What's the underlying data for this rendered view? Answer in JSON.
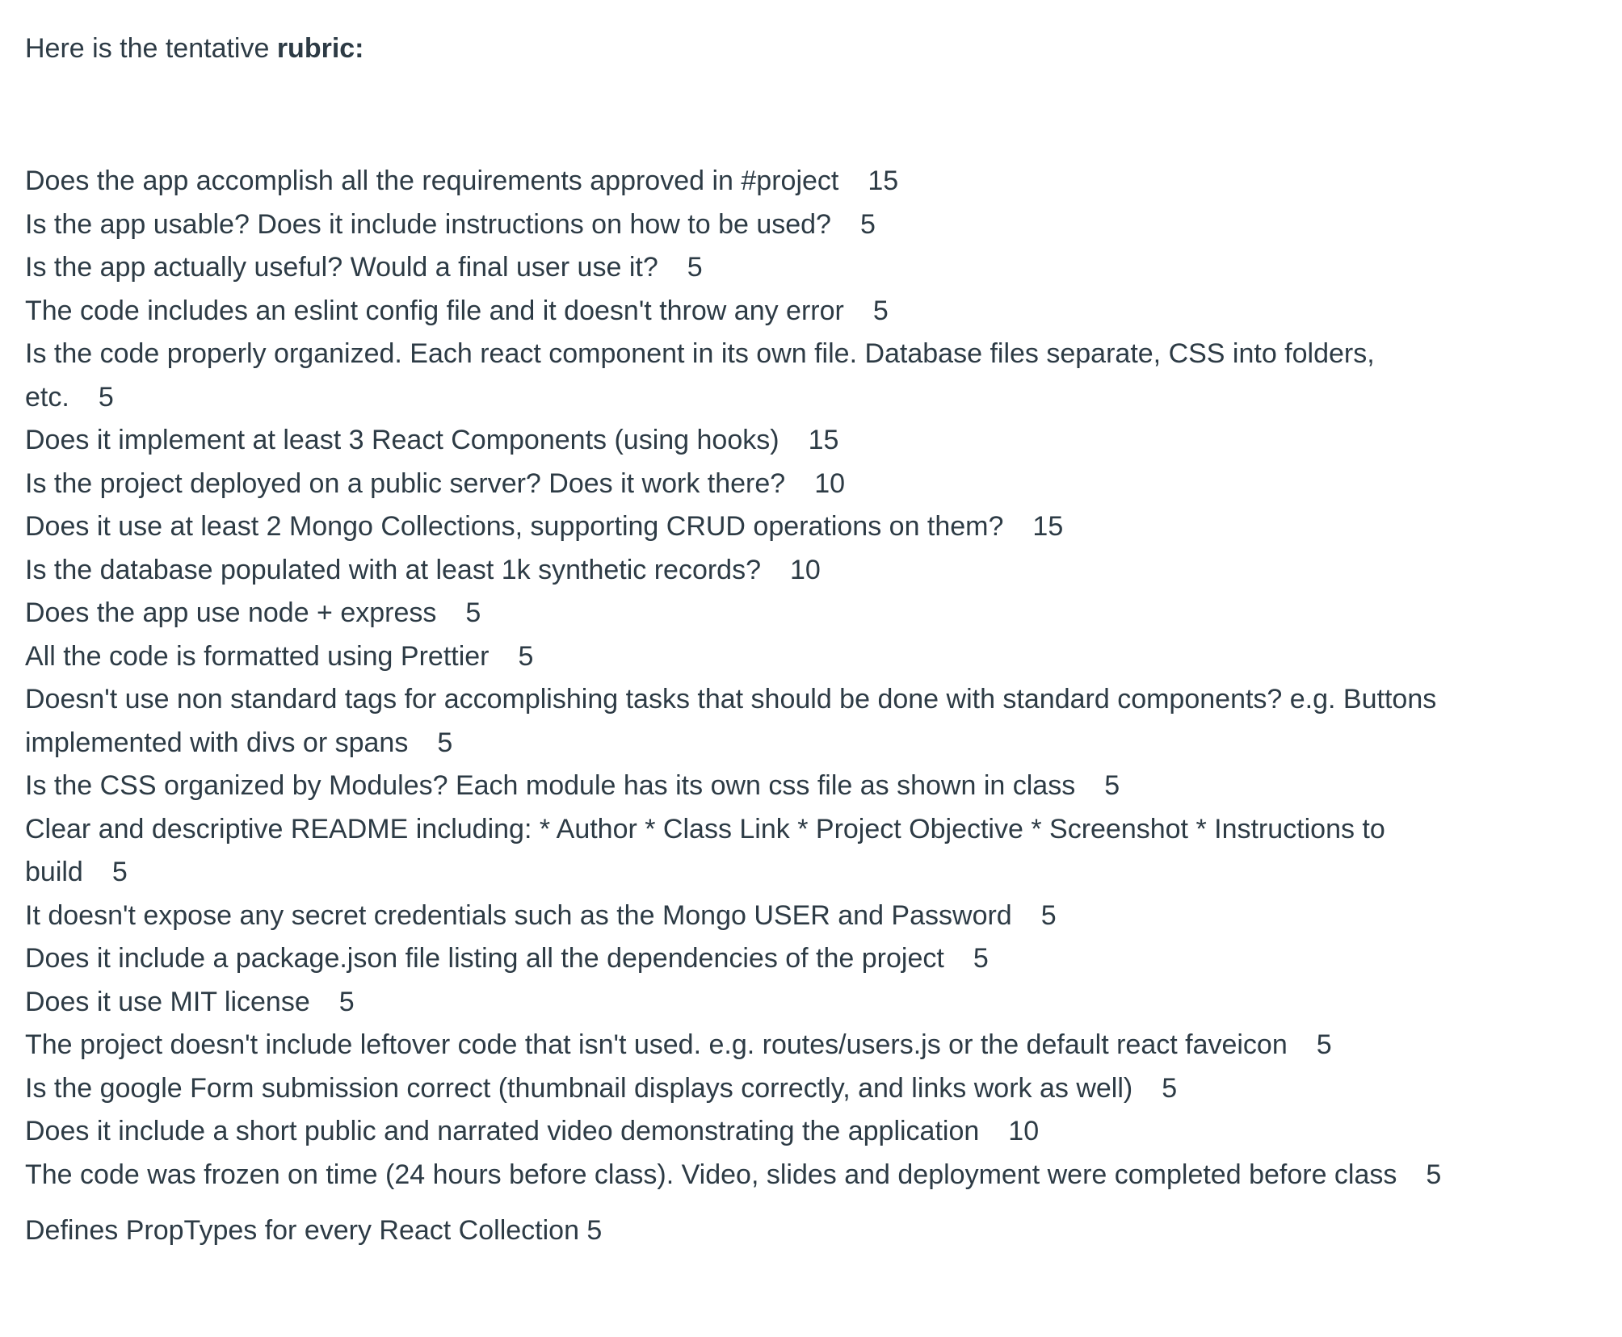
{
  "intro": {
    "text": "Here is the tentative ",
    "bold": "rubric:"
  },
  "items": [
    {
      "text": "Does the app accomplish all the requirements approved in #project",
      "points": "15"
    },
    {
      "text": "Is the app usable? Does it include instructions on how to be used?",
      "points": "5"
    },
    {
      "text": "Is the app actually useful? Would a final user use it?",
      "points": "5"
    },
    {
      "text": "The code includes an eslint config file and it doesn't throw any error",
      "points": "5"
    },
    {
      "text": "Is the code properly organized. Each react component in its own file. Database files separate, CSS into folders, etc.",
      "points": "5"
    },
    {
      "text": "Does it implement at least 3 React Components (using hooks)",
      "points": "15"
    },
    {
      "text": "Is the project deployed on a public server? Does it work there?",
      "points": "10"
    },
    {
      "text": "Does it use at least 2 Mongo Collections, supporting CRUD operations on them?",
      "points": "15"
    },
    {
      "text": "Is the database populated with at least 1k synthetic records?",
      "points": "10"
    },
    {
      "text": "Does the app use node + express",
      "points": "5"
    },
    {
      "text": "All the code is formatted using Prettier",
      "points": "5"
    },
    {
      "text": "Doesn't use non standard tags for accomplishing tasks that should be done with standard components? e.g. Buttons implemented with divs or spans",
      "points": "5"
    },
    {
      "text": "Is the CSS organized by Modules? Each module has its own css file as shown in class",
      "points": "5"
    },
    {
      "text": "Clear and descriptive README including: * Author * Class Link * Project Objective * Screenshot * Instructions to build",
      "points": "5"
    },
    {
      "text": "It doesn't expose any secret credentials such as the Mongo USER and Password",
      "points": "5"
    },
    {
      "text": "Does it include a package.json file listing all the dependencies of the project",
      "points": "5"
    },
    {
      "text": "Does it use MIT license",
      "points": "5"
    },
    {
      "text": "The project doesn't include leftover code that isn't used. e.g. routes/users.js or the default react faveicon",
      "points": "5"
    },
    {
      "text": "Is the google Form submission correct (thumbnail displays correctly, and links work as well)",
      "points": "5"
    },
    {
      "text": "Does it include a short public and narrated video demonstrating the application",
      "points": "10"
    },
    {
      "text": "The code was frozen on time (24 hours before class). Video, slides and deployment were completed before class",
      "points": "5"
    }
  ],
  "final_item": "Defines PropTypes for every React Collection 5"
}
